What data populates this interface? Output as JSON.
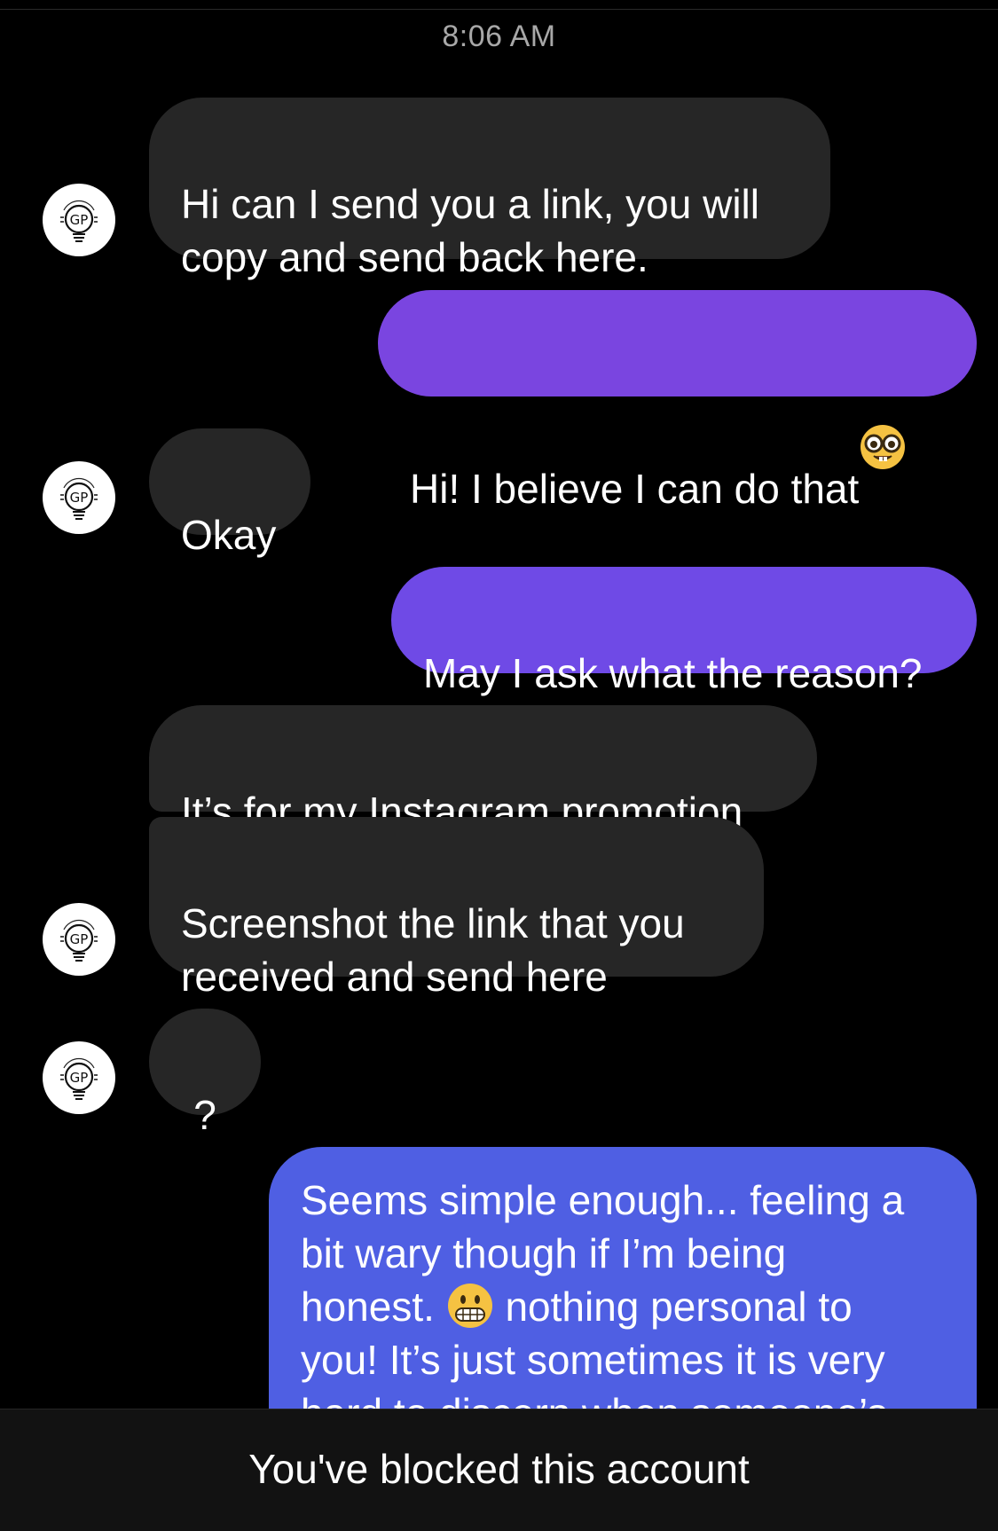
{
  "thread": {
    "timestamp": "8:06 AM"
  },
  "avatar": {
    "initials": "GP",
    "arc_text": "SUNLIGHTS"
  },
  "messages": [
    {
      "from": "them",
      "text": "Hi can I send you a link, you will\ncopy and send back here."
    },
    {
      "from": "me",
      "text": "Hi! I believe I can do that",
      "emoji": "nerd-face"
    },
    {
      "from": "them",
      "text": "Okay"
    },
    {
      "from": "me",
      "text": "May I ask what the reason?"
    },
    {
      "from": "them",
      "text": "It’s for my Instagram promotion"
    },
    {
      "from": "them",
      "text": "Screenshot the link that you\nreceived and send here"
    },
    {
      "from": "them",
      "text": "?"
    },
    {
      "from": "me",
      "line1": "Seems simple enough... feeling a",
      "line2": "bit wary though if I’m being",
      "line3_a": "honest. ",
      "line3_emoji": "grimacing-face",
      "line3_b": " nothing personal to",
      "line4": "you! It’s just sometimes it is very",
      "line5": "hard to discern when someone’s"
    }
  ],
  "footer": {
    "blocked_label": "You've blocked this account"
  },
  "colors": {
    "background": "#000000",
    "incoming_bubble": "#262626",
    "outgoing_purple": "#7a45e0",
    "outgoing_violet": "#6f4ae6",
    "outgoing_blue": "#4f5fe3",
    "timestamp": "#a8a8a8"
  }
}
